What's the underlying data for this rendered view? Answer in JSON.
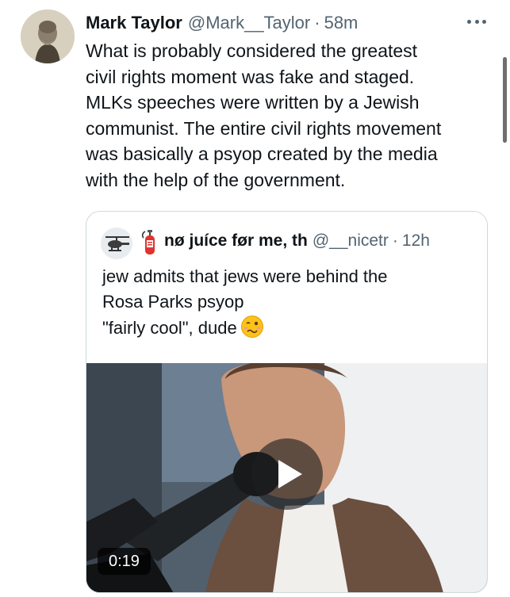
{
  "tweet": {
    "author_name": "Mark Taylor",
    "author_handle": "@Mark__Taylor",
    "separator": "·",
    "time": "58m",
    "text": "What is probably considered the greatest\ncivil rights moment was fake and staged.\nMLKs speeches were written by a Jewish\ncommunist. The entire civil rights movement\nwas basically a psyop created by the media\nwith the help of the government.",
    "more_icon": "ellipsis-icon"
  },
  "quote": {
    "author_emoji_icon": "fire-extinguisher-icon",
    "author_name": "nø juíce før me, th",
    "author_handle": "@__nicetr",
    "separator": "·",
    "time": "12h",
    "text_lines": [
      "jew admits that jews were behind the",
      "Rosa Parks psyop",
      "\"fairly cool\", dude"
    ],
    "text_emoji_icon": "woozy-face-icon",
    "video": {
      "duration": "0:19",
      "play_icon": "play-icon"
    }
  },
  "colors": {
    "text": "#0f1419",
    "secondary_text": "#536471",
    "border": "#cfd9de"
  }
}
